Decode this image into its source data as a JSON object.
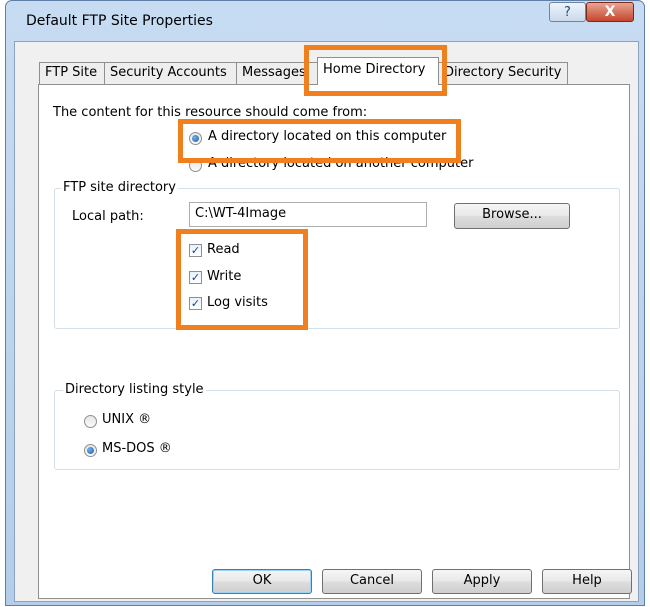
{
  "window": {
    "title": "Default FTP Site Properties",
    "help_glyph": "?",
    "close_glyph": "X"
  },
  "tabs": [
    {
      "label": "FTP Site"
    },
    {
      "label": "Security Accounts"
    },
    {
      "label": "Messages"
    },
    {
      "label": "Home Directory",
      "active": true
    },
    {
      "label": "Directory Security"
    }
  ],
  "home_directory": {
    "source_label": "The content for this resource should come from:",
    "source_options": [
      {
        "label": "A directory located on this computer",
        "selected": true
      },
      {
        "label": "A directory located on another computer",
        "selected": false
      }
    ],
    "site_directory": {
      "legend": "FTP site directory",
      "local_path_label": "Local path:",
      "local_path_value": "C:\\WT-4Image",
      "browse_label": "Browse...",
      "permissions": [
        {
          "label": "Read",
          "checked": true
        },
        {
          "label": "Write",
          "checked": true
        },
        {
          "label": "Log visits",
          "checked": true
        }
      ]
    },
    "listing_style": {
      "legend": "Directory listing style",
      "options": [
        {
          "label": "UNIX ®",
          "selected": false
        },
        {
          "label": "MS-DOS ®",
          "selected": true
        }
      ]
    }
  },
  "buttons": {
    "ok": "OK",
    "cancel": "Cancel",
    "apply": "Apply",
    "help": "Help"
  },
  "check_glyph": "✓",
  "annotation_color": "#f07f1f"
}
